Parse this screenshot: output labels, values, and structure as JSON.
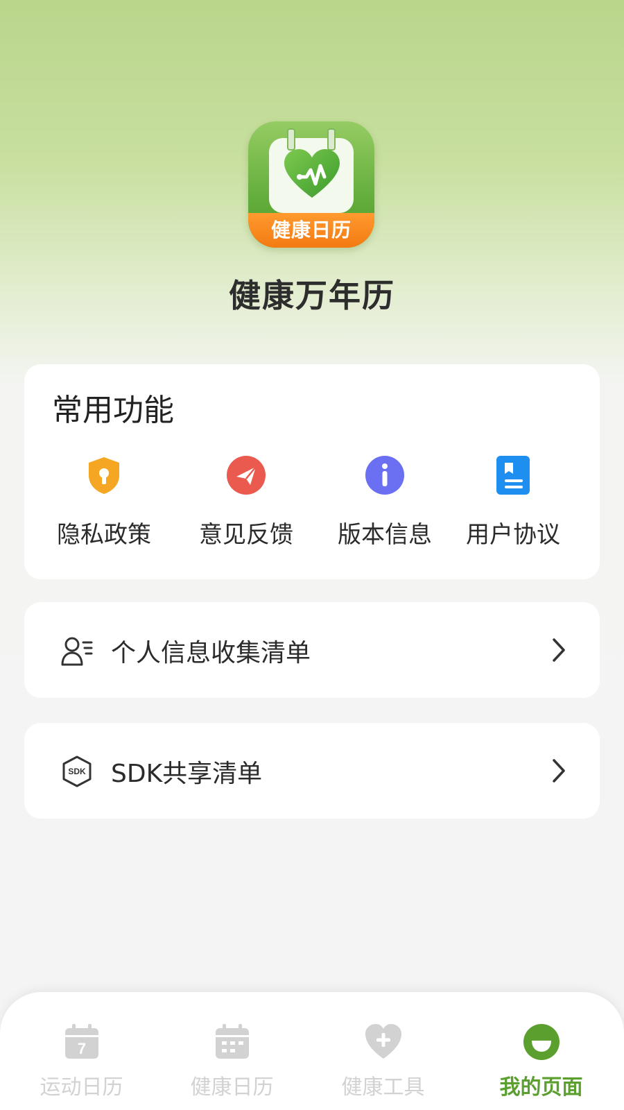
{
  "app": {
    "logo_text": "健康日历",
    "name": "健康万年历"
  },
  "functions": {
    "title": "常用功能",
    "items": [
      {
        "label": "隐私政策",
        "icon": "shield-lock-icon",
        "color": "#f5a623"
      },
      {
        "label": "意见反馈",
        "icon": "paper-plane-icon",
        "color": "#ea5a4f"
      },
      {
        "label": "版本信息",
        "icon": "info-icon",
        "color": "#6b6ff2"
      },
      {
        "label": "用户协议",
        "icon": "document-icon",
        "color": "#1e8ef0"
      }
    ]
  },
  "list": [
    {
      "label": "个人信息收集清单",
      "icon": "user-list-icon"
    },
    {
      "label": "SDK共享清单",
      "icon": "sdk-hexagon-icon",
      "icon_text": "SDK"
    }
  ],
  "tabbar": {
    "items": [
      {
        "label": "运动日历",
        "icon": "calendar-7-icon",
        "active": false
      },
      {
        "label": "健康日历",
        "icon": "calendar-grid-icon",
        "active": false
      },
      {
        "label": "健康工具",
        "icon": "heart-plus-icon",
        "active": false
      },
      {
        "label": "我的页面",
        "icon": "smile-icon",
        "active": true
      }
    ],
    "active_color": "#5b9f2f",
    "inactive_color": "#d2d2d2"
  },
  "colors": {
    "header_green": "#b9d68b",
    "background": "#f4f4f4",
    "logo_orange": "#f37a12"
  }
}
